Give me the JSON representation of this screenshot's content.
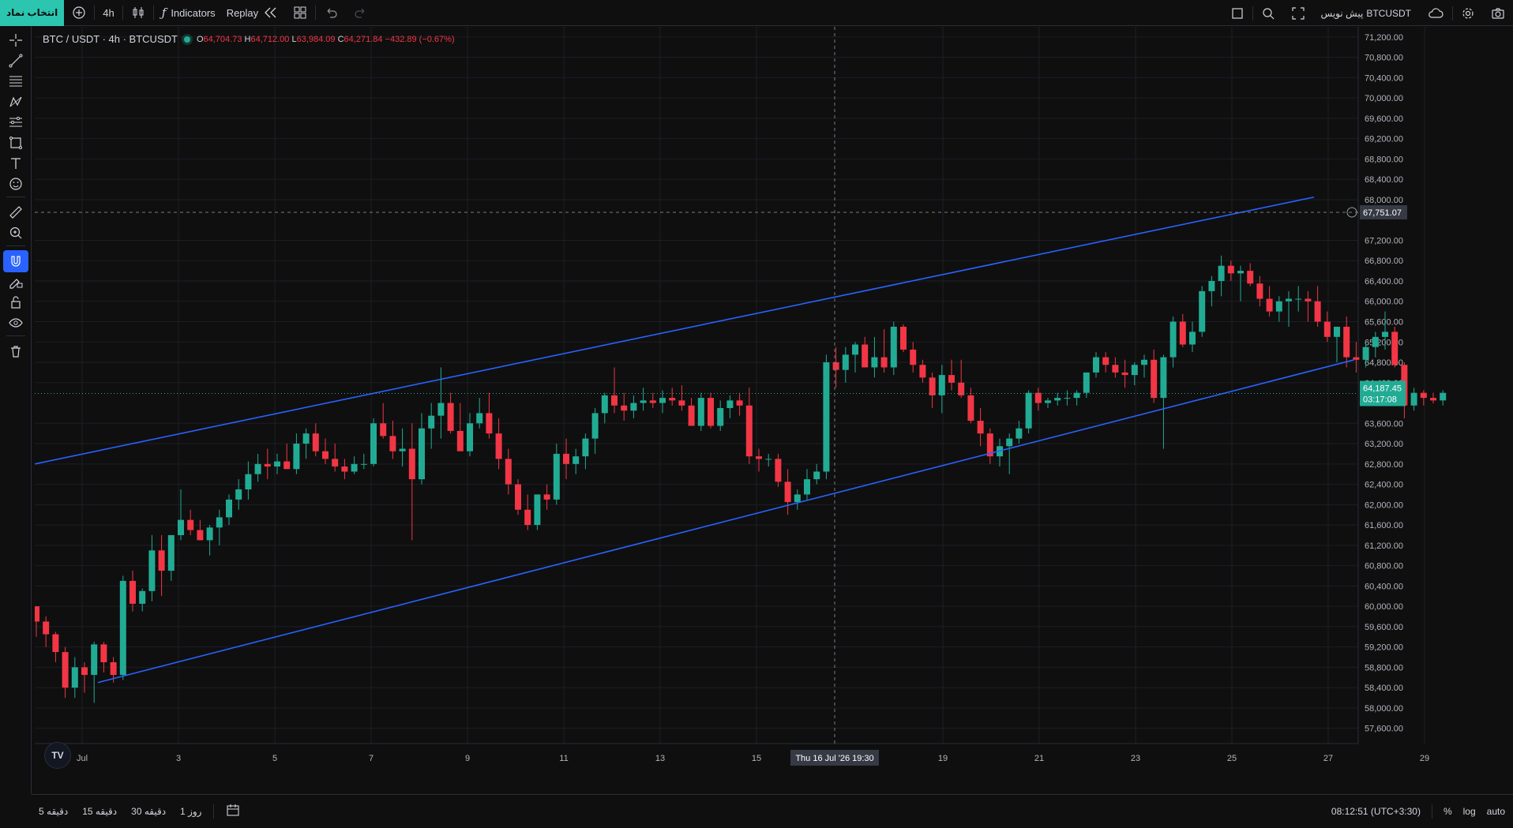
{
  "topbar": {
    "symbol_select_label": "انتخاب نماد",
    "interval": "4h",
    "indicators_label": "Indicators",
    "replay_label": "Replay",
    "symbol_title": "BTCUSDT",
    "title_suffix": "پیش نویس"
  },
  "legend": {
    "symbol": "BTC / USDT · 4h · BTCUSDT",
    "open_label": "O",
    "open": "64,704.73",
    "high_label": "H",
    "high": "64,712.00",
    "low_label": "L",
    "low": "63,984.09",
    "close_label": "C",
    "close": "64,271.84",
    "change": "−432.89 (−0.67%)"
  },
  "price_axis": {
    "ticks": [
      "71,200.00",
      "70,800.00",
      "70,400.00",
      "70,000.00",
      "69,600.00",
      "69,200.00",
      "68,800.00",
      "68,400.00",
      "68,000.00",
      "67,200.00",
      "66,800.00",
      "66,400.00",
      "66,000.00",
      "65,600.00",
      "65,200.00",
      "64,800.00",
      "64,400.00",
      "63,600.00",
      "63,200.00",
      "62,800.00",
      "62,400.00",
      "62,000.00",
      "61,600.00",
      "61,200.00",
      "60,800.00",
      "60,400.00",
      "60,000.00",
      "59,600.00",
      "59,200.00",
      "58,800.00",
      "58,400.00",
      "58,000.00",
      "57,600.00"
    ],
    "crosshair_price": "67,751.07",
    "last_price": "64,187.45",
    "countdown": "03:17:08"
  },
  "time_axis": {
    "ticks": [
      "Jul",
      "3",
      "5",
      "7",
      "9",
      "11",
      "13",
      "15",
      "19",
      "21",
      "23",
      "25",
      "27",
      "29"
    ],
    "crosshair_label": "Thu 16 Jul '26   19:30"
  },
  "bottombar": {
    "ranges": [
      "5 دقیقه",
      "15 دقیقه",
      "30 دقیقه",
      "1 روز"
    ],
    "clock": "08:12:51 (UTC+3:30)",
    "percent": "%",
    "log": "log",
    "auto": "auto"
  },
  "colors": {
    "up": "#22ab94",
    "down": "#f23645",
    "channel": "#2962ff",
    "accent": "#2cc6b0"
  },
  "icons": [
    "crosshair-icon",
    "trendline-icon",
    "fib-icon",
    "pattern-icon",
    "projection-icon",
    "shapes-icon",
    "text-icon",
    "emoji-icon",
    "ruler-icon",
    "zoom-icon",
    "magnet-icon",
    "brush-lock-icon",
    "lock-icon",
    "eye-icon",
    "trash-icon"
  ],
  "chart_data": {
    "type": "candlestick",
    "symbol": "BTCUSDT",
    "interval": "4h",
    "ylim": [
      57300,
      71400
    ],
    "x_labels": [
      "Jul",
      "3",
      "5",
      "7",
      "9",
      "11",
      "13",
      "15",
      "19",
      "21",
      "23",
      "25",
      "27",
      "29"
    ],
    "ohlc_series": [
      [
        60000,
        60000,
        59400,
        59700
      ],
      [
        59700,
        59800,
        59200,
        59450
      ],
      [
        59450,
        59500,
        58900,
        59100
      ],
      [
        59100,
        59200,
        58200,
        58400
      ],
      [
        58400,
        59000,
        58200,
        58800
      ],
      [
        58800,
        58900,
        58300,
        58650
      ],
      [
        58650,
        59300,
        58100,
        59250
      ],
      [
        59250,
        59300,
        58700,
        58900
      ],
      [
        58900,
        59000,
        58500,
        58650
      ],
      [
        58650,
        60600,
        58550,
        60500
      ],
      [
        60500,
        60700,
        59900,
        60050
      ],
      [
        60050,
        60350,
        59900,
        60300
      ],
      [
        60300,
        61400,
        60100,
        61100
      ],
      [
        61100,
        61400,
        60200,
        60700
      ],
      [
        60700,
        61400,
        60500,
        61400
      ],
      [
        61400,
        62300,
        61300,
        61700
      ],
      [
        61700,
        61900,
        61400,
        61500
      ],
      [
        61500,
        61700,
        61300,
        61300
      ],
      [
        61300,
        61600,
        61000,
        61550
      ],
      [
        61550,
        61900,
        61200,
        61750
      ],
      [
        61750,
        62200,
        61600,
        62100
      ],
      [
        62100,
        62500,
        61900,
        62300
      ],
      [
        62300,
        62850,
        62100,
        62600
      ],
      [
        62600,
        63000,
        62450,
        62800
      ],
      [
        62800,
        63100,
        62500,
        62750
      ],
      [
        62750,
        63000,
        62600,
        62850
      ],
      [
        62850,
        63200,
        62700,
        62700
      ],
      [
        62700,
        63400,
        62600,
        63200
      ],
      [
        63200,
        63500,
        62900,
        63400
      ],
      [
        63400,
        63600,
        62950,
        63050
      ],
      [
        63050,
        63300,
        62800,
        62900
      ],
      [
        62900,
        63200,
        62650,
        62750
      ],
      [
        62750,
        62900,
        62500,
        62650
      ],
      [
        62650,
        62950,
        62600,
        62800
      ],
      [
        62800,
        63000,
        62700,
        62800
      ],
      [
        62800,
        63700,
        62750,
        63600
      ],
      [
        63600,
        64000,
        63300,
        63350
      ],
      [
        63350,
        63650,
        62900,
        63050
      ],
      [
        63050,
        63500,
        62750,
        63100
      ],
      [
        63100,
        63600,
        61300,
        62500
      ],
      [
        62500,
        63800,
        62400,
        63500
      ],
      [
        63500,
        64000,
        63100,
        63750
      ],
      [
        63750,
        64700,
        63300,
        64000
      ],
      [
        64000,
        64200,
        63400,
        63450
      ],
      [
        63450,
        64000,
        63100,
        63050
      ],
      [
        63050,
        63800,
        62950,
        63600
      ],
      [
        63600,
        64100,
        63500,
        63800
      ],
      [
        63800,
        64200,
        63300,
        63400
      ],
      [
        63400,
        63700,
        62700,
        62900
      ],
      [
        62900,
        63100,
        62200,
        62400
      ],
      [
        62400,
        62500,
        61800,
        61900
      ],
      [
        61900,
        62200,
        61500,
        61600
      ],
      [
        61600,
        62200,
        61500,
        62200
      ],
      [
        62200,
        62400,
        61900,
        62100
      ],
      [
        62100,
        63200,
        62000,
        63000
      ],
      [
        63000,
        63300,
        62500,
        62800
      ],
      [
        62800,
        63100,
        62600,
        62950
      ],
      [
        62950,
        63400,
        62700,
        63300
      ],
      [
        63300,
        63900,
        63000,
        63800
      ],
      [
        63800,
        64200,
        63600,
        64150
      ],
      [
        64150,
        64700,
        63800,
        63950
      ],
      [
        63950,
        64200,
        63650,
        63850
      ],
      [
        63850,
        64150,
        63700,
        64000
      ],
      [
        64000,
        64300,
        63850,
        64050
      ],
      [
        64050,
        64200,
        63900,
        64000
      ],
      [
        64000,
        64250,
        63800,
        64100
      ],
      [
        64100,
        64300,
        63950,
        64050
      ],
      [
        64050,
        64350,
        63850,
        63950
      ],
      [
        63950,
        64100,
        63550,
        63550
      ],
      [
        63550,
        64200,
        63450,
        64100
      ],
      [
        64100,
        64200,
        63500,
        63550
      ],
      [
        63550,
        64050,
        63450,
        63900
      ],
      [
        63900,
        64150,
        63700,
        64050
      ],
      [
        64050,
        64200,
        63750,
        63950
      ],
      [
        63950,
        64300,
        62800,
        62950
      ],
      [
        62950,
        63100,
        62650,
        62900
      ],
      [
        62900,
        63000,
        62750,
        62900
      ],
      [
        62900,
        63000,
        62350,
        62450
      ],
      [
        62450,
        62700,
        61800,
        62050
      ],
      [
        62050,
        62300,
        61900,
        62200
      ],
      [
        62200,
        62700,
        62100,
        62500
      ],
      [
        62500,
        62800,
        62400,
        62650
      ],
      [
        62650,
        64950,
        62500,
        64800
      ],
      [
        64800,
        65100,
        64300,
        64650
      ],
      [
        64650,
        65100,
        64400,
        64950
      ],
      [
        64950,
        65200,
        64600,
        65150
      ],
      [
        65150,
        65300,
        64700,
        64700
      ],
      [
        64700,
        65300,
        64500,
        64900
      ],
      [
        64900,
        65450,
        64600,
        64700
      ],
      [
        64700,
        65600,
        64550,
        65500
      ],
      [
        65500,
        65550,
        65000,
        65050
      ],
      [
        65050,
        65200,
        64600,
        64750
      ],
      [
        64750,
        64850,
        64400,
        64500
      ],
      [
        64500,
        64600,
        63900,
        64150
      ],
      [
        64150,
        64750,
        63800,
        64550
      ],
      [
        64550,
        64850,
        64250,
        64400
      ],
      [
        64400,
        64850,
        64100,
        64150
      ],
      [
        64150,
        64300,
        63600,
        63650
      ],
      [
        63650,
        63900,
        63150,
        63400
      ],
      [
        63400,
        63500,
        62800,
        62950
      ],
      [
        62950,
        63300,
        62750,
        63150
      ],
      [
        63150,
        63400,
        62600,
        63300
      ],
      [
        63300,
        63650,
        63200,
        63500
      ],
      [
        63500,
        64250,
        63400,
        64200
      ],
      [
        64200,
        64300,
        63850,
        64000
      ],
      [
        64000,
        64100,
        63900,
        64050
      ],
      [
        64050,
        64200,
        63950,
        64100
      ],
      [
        64100,
        64250,
        63950,
        64100
      ],
      [
        64100,
        64250,
        63950,
        64200
      ],
      [
        64200,
        64550,
        64100,
        64600
      ],
      [
        64600,
        65000,
        64500,
        64900
      ],
      [
        64900,
        65000,
        64600,
        64750
      ],
      [
        64750,
        64900,
        64500,
        64600
      ],
      [
        64600,
        64850,
        64300,
        64550
      ],
      [
        64550,
        64800,
        64350,
        64750
      ],
      [
        64750,
        64950,
        64500,
        64850
      ],
      [
        64850,
        65050,
        64000,
        64100
      ],
      [
        64100,
        64950,
        63100,
        64900
      ],
      [
        64900,
        65700,
        64700,
        65600
      ],
      [
        65600,
        65750,
        65100,
        65150
      ],
      [
        65150,
        65600,
        65000,
        65400
      ],
      [
        65400,
        66300,
        65300,
        66200
      ],
      [
        66200,
        66500,
        65900,
        66400
      ],
      [
        66400,
        66900,
        66100,
        66700
      ],
      [
        66700,
        66800,
        66400,
        66550
      ],
      [
        66550,
        66700,
        66000,
        66600
      ],
      [
        66600,
        66750,
        66300,
        66350
      ],
      [
        66350,
        66500,
        65900,
        66050
      ],
      [
        66050,
        66300,
        65700,
        65800
      ],
      [
        65800,
        66100,
        65600,
        66000
      ],
      [
        66000,
        66200,
        65500,
        66050
      ],
      [
        66050,
        66300,
        65800,
        66050
      ],
      [
        66050,
        66200,
        65600,
        66000
      ],
      [
        66000,
        66300,
        65500,
        65600
      ],
      [
        65600,
        65800,
        65200,
        65300
      ],
      [
        65300,
        65500,
        64800,
        65500
      ],
      [
        65500,
        65700,
        64700,
        64900
      ],
      [
        64900,
        65200,
        64600,
        64850
      ],
      [
        64850,
        65200,
        64700,
        65100
      ],
      [
        65100,
        65400,
        64900,
        65300
      ],
      [
        65300,
        65800,
        65050,
        65400
      ],
      [
        65400,
        65500,
        64700,
        64750
      ],
      [
        64750,
        64800,
        63700,
        63950
      ],
      [
        63950,
        64300,
        63850,
        64200
      ],
      [
        64200,
        64250,
        63950,
        64100
      ],
      [
        64100,
        64200,
        63990,
        64050
      ],
      [
        64050,
        64250,
        63950,
        64200
      ]
    ],
    "annotations": {
      "parallel_channel": {
        "upper": [
          [
            62800,
            68050
          ]
        ],
        "lower": [
          [
            58500,
            64850
          ]
        ]
      },
      "horizontal_crosshair_price": 67751.07,
      "last_price_line": 64187.45
    }
  }
}
